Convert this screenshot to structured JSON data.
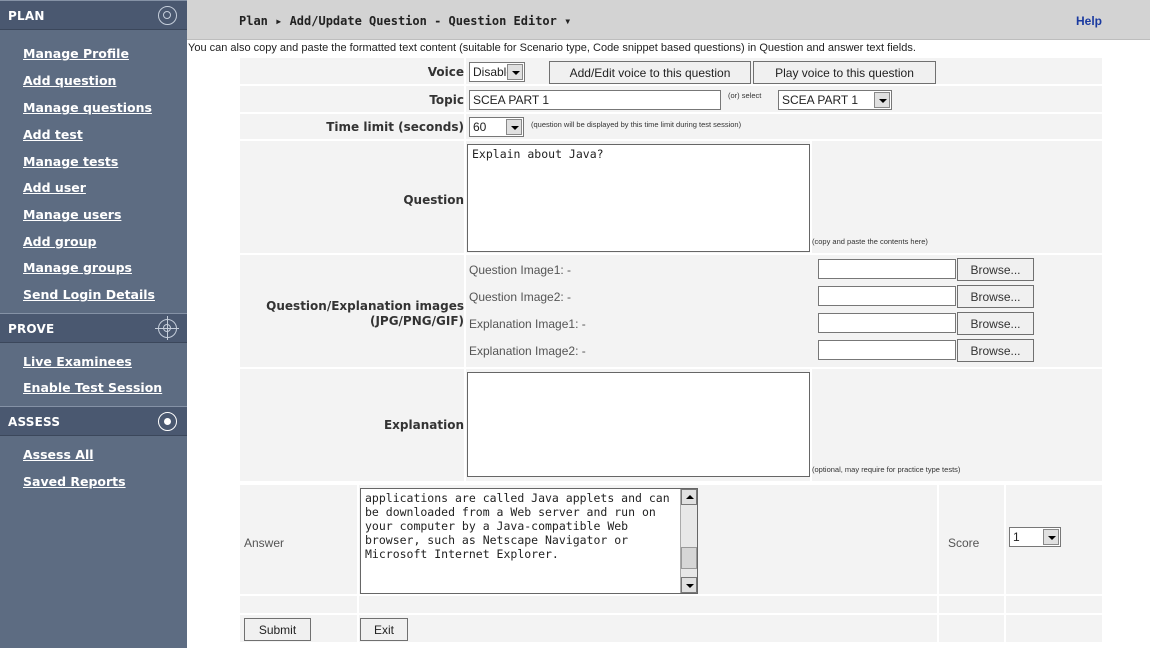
{
  "sidebar": {
    "sections": [
      {
        "title": "PLAN",
        "icon": "target-ring-icon"
      },
      {
        "title": "PROVE",
        "icon": "crosshair-icon"
      },
      {
        "title": "ASSESS",
        "icon": "target-icon"
      }
    ],
    "plan_links": [
      "Manage Profile",
      "Add question",
      "Manage questions",
      "Add test",
      "Manage tests",
      "Add user",
      "Manage users",
      "Add group",
      "Manage groups",
      "Send Login Details"
    ],
    "prove_links": [
      "Live Examinees",
      "Enable Test Session"
    ],
    "assess_links": [
      "Assess All",
      "Saved Reports"
    ]
  },
  "header": {
    "breadcrumb": "Plan ▸ Add/Update Question - Question Editor ▾",
    "help": "Help"
  },
  "note": "You can also copy and paste the formatted text content (suitable for Scenario type, Code snippet based questions) in Question and answer text fields.",
  "form": {
    "voice": {
      "label": "Voice",
      "value": "Disable",
      "add_edit_button": "Add/Edit voice to this question",
      "play_button": "Play voice to this question"
    },
    "topic": {
      "label": "Topic",
      "value": "SCEA PART 1",
      "or_select": "(or) select",
      "select_value": "SCEA PART 1"
    },
    "time_limit": {
      "label": "Time limit (seconds)",
      "value": "60",
      "hint": "(question will be displayed by this time limit during test session)"
    },
    "question": {
      "label": "Question",
      "value": "Explain about Java?",
      "hint": "(copy and paste the contents here)"
    },
    "images": {
      "label_line1": "Question/Explanation images",
      "label_line2": "(JPG/PNG/GIF)",
      "items": [
        "Question Image1:    -",
        "Question Image2:    -",
        "Explanation Image1: -",
        "Explanation Image2: -"
      ],
      "browse": "Browse..."
    },
    "explanation": {
      "label": "Explanation",
      "value": "",
      "hint": "(optional, may require for practice type tests)"
    },
    "answer": {
      "label": "Answer",
      "value": "applications are called Java applets and can be downloaded from a Web server and run on your computer by a Java-compatible Web browser, such as Netscape Navigator or Microsoft Internet Explorer.",
      "score_label": "Score",
      "score_value": "1"
    },
    "buttons": {
      "submit": "Submit",
      "exit": "Exit"
    }
  },
  "colors": {
    "sidebar": "#5d6c82",
    "sidebar_header": "#4a5870",
    "topbar": "#d3d3d3",
    "row": "#f3f3f3",
    "help_link": "#1a3aa0"
  }
}
